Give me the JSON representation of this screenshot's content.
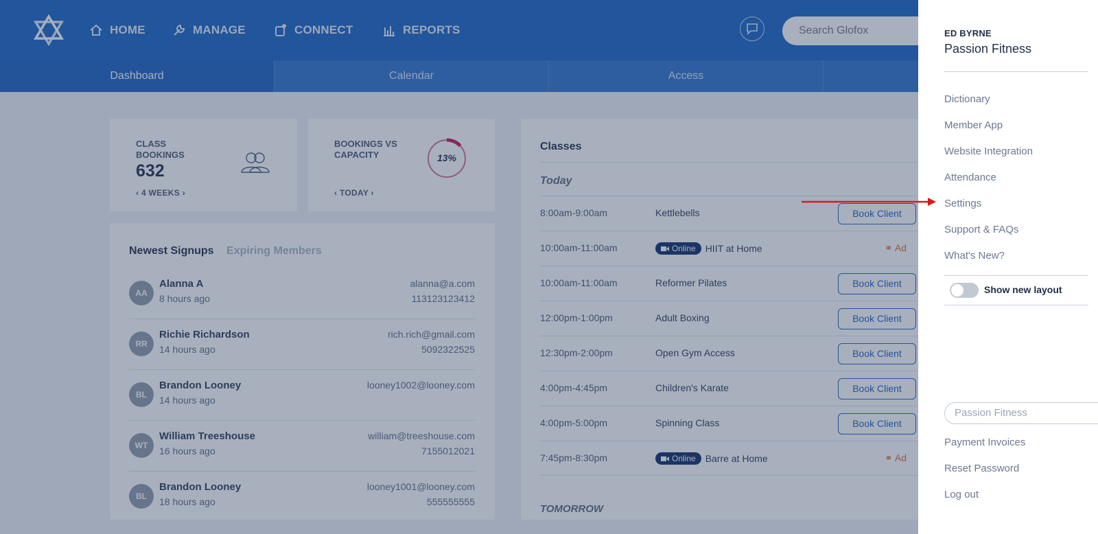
{
  "nav": {
    "items": [
      {
        "label": "HOME",
        "icon": "home-icon"
      },
      {
        "label": "MANAGE",
        "icon": "wrench-icon"
      },
      {
        "label": "CONNECT",
        "icon": "connect-icon"
      },
      {
        "label": "REPORTS",
        "icon": "reports-icon"
      }
    ],
    "search_placeholder": "Search Glofox"
  },
  "subnav": {
    "tabs": [
      {
        "label": "Dashboard",
        "active": true
      },
      {
        "label": "Calendar",
        "active": false
      },
      {
        "label": "Access",
        "active": false
      },
      {
        "label": "",
        "active": false
      }
    ]
  },
  "stats": {
    "class_bookings": {
      "label_line1": "CLASS",
      "label_line2": "BOOKINGS",
      "value": "632",
      "range": "4 WEEKS"
    },
    "bookings_vs_capacity": {
      "label_line1": "BOOKINGS VS",
      "label_line2": "CAPACITY",
      "percent_text": "13%",
      "percent": 13,
      "range": "TODAY"
    }
  },
  "signups": {
    "tab_active": "Newest Signups",
    "tab_inactive": "Expiring Members",
    "rows": [
      {
        "initials": "AA",
        "name": "Alanna A",
        "time": "8 hours ago",
        "email": "alanna@a.com",
        "phone": "113123123412"
      },
      {
        "initials": "RR",
        "name": "Richie Richardson",
        "time": "14 hours ago",
        "email": "rich.rich@gmail.com",
        "phone": "5092322525"
      },
      {
        "initials": "BL",
        "name": "Brandon Looney",
        "time": "14 hours ago",
        "email": "looney1002@looney.com",
        "phone": ""
      },
      {
        "initials": "WT",
        "name": "William Treeshouse",
        "time": "16 hours ago",
        "email": "william@treeshouse.com",
        "phone": "7155012021"
      },
      {
        "initials": "BL",
        "name": "Brandon Looney",
        "time": "18 hours ago",
        "email": "looney1001@looney.com",
        "phone": "555555555"
      }
    ]
  },
  "classes": {
    "title": "Classes",
    "today_label": "Today",
    "tomorrow_label": "TOMORROW",
    "book_label": "Book Client",
    "online_label": "Online",
    "add_label": "Ad",
    "rows": [
      {
        "time": "8:00am-9:00am",
        "name": "Kettlebells",
        "online": false
      },
      {
        "time": "10:00am-11:00am",
        "name": "HIIT at Home",
        "online": true
      },
      {
        "time": "10:00am-11:00am",
        "name": "Reformer Pilates",
        "online": false
      },
      {
        "time": "12:00pm-1:00pm",
        "name": "Adult Boxing",
        "online": false
      },
      {
        "time": "12:30pm-2:00pm",
        "name": "Open Gym Access",
        "online": false
      },
      {
        "time": "4:00pm-4:45pm",
        "name": "Children's Karate",
        "online": false
      },
      {
        "time": "4:00pm-5:00pm",
        "name": "Spinning Class",
        "online": false
      },
      {
        "time": "7:45pm-8:30pm",
        "name": "Barre at Home",
        "online": true
      }
    ]
  },
  "panel": {
    "user_name": "ED BYRNE",
    "gym_name": "Passion Fitness",
    "links": [
      "Dictionary",
      "Member App",
      "Website Integration",
      "Attendance",
      "Settings",
      "Support & FAQs",
      "What's New?"
    ],
    "toggle_label": "Show new layout",
    "toggle_on": false,
    "select_value": "Passion Fitness",
    "bottom_links": [
      "Payment Invoices",
      "Reset Password",
      "Log out"
    ]
  },
  "colors": {
    "brand_blue": "#1763c4",
    "accent_magenta": "#c0185b",
    "annotation_arrow": "#e0161b",
    "online_badge": "#0e2a66",
    "add_orange": "#e0672b"
  }
}
